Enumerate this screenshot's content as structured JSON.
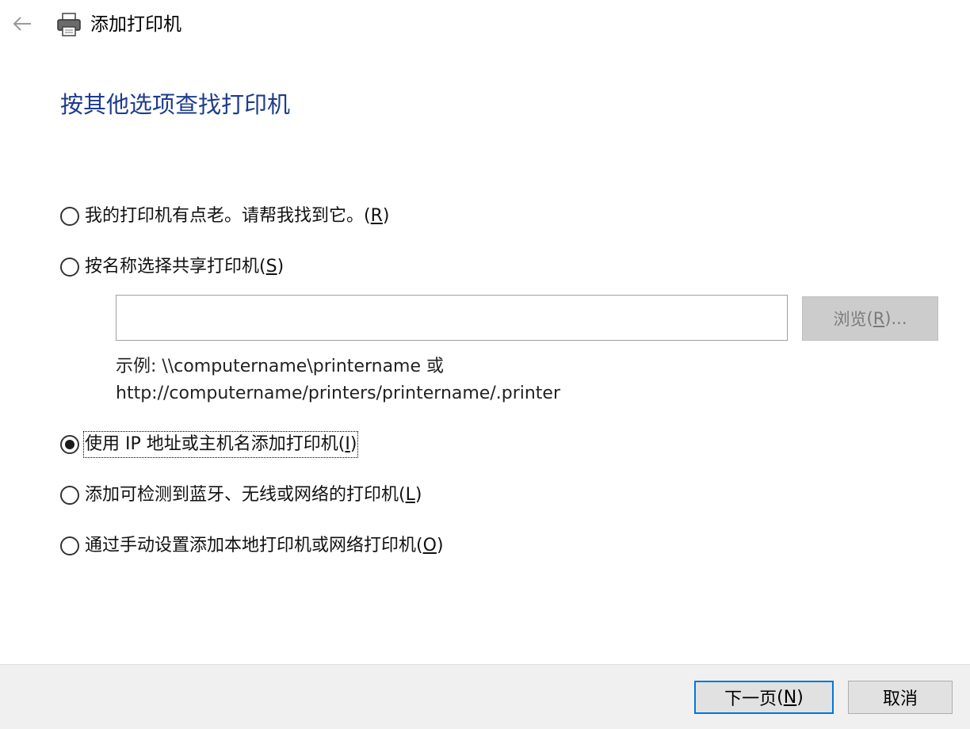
{
  "header": {
    "title": "添加打印机",
    "back_icon": "back-arrow-icon",
    "printer_icon": "printer-icon"
  },
  "heading": "按其他选项查找打印机",
  "options": [
    {
      "text": "我的打印机有点老。请帮我找到它。",
      "key": "R",
      "checked": false
    },
    {
      "text": "按名称选择共享打印机",
      "key": "S",
      "checked": false
    },
    {
      "text": "使用 IP 地址或主机名添加打印机",
      "key": "I",
      "checked": true
    },
    {
      "text": "添加可检测到蓝牙、无线或网络的打印机",
      "key": "L",
      "checked": false
    },
    {
      "text": "通过手动设置添加本地打印机或网络打印机",
      "key": "O",
      "checked": false
    }
  ],
  "share_input": {
    "value": "",
    "placeholder": ""
  },
  "browse_button": {
    "text": "浏览",
    "key": "R",
    "suffix": "...",
    "enabled": false
  },
  "example": {
    "line1": "示例: \\\\computername\\printername 或",
    "line2": "http://computername/printers/printername/.printer"
  },
  "footer": {
    "next": {
      "text": "下一页",
      "key": "N"
    },
    "cancel": "取消"
  },
  "colors": {
    "heading": "#1e3c8c",
    "focus_border": "#0078d7",
    "footer_bg": "#f0f0f0",
    "disabled_bg": "#cccccc"
  }
}
